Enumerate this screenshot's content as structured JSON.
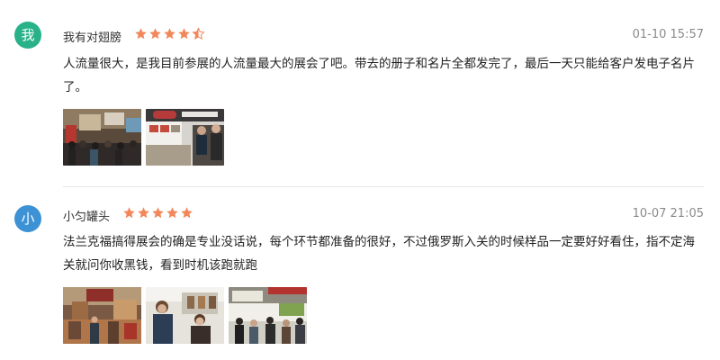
{
  "reviews": [
    {
      "avatar_char": "我",
      "avatar_color": "#29b189",
      "username": "我有对翅膀",
      "rating": 4.5,
      "timestamp": "01-10 15:57",
      "content": "人流量很大，是我目前参展的人流量最大的展会了吧。带去的册子和名片全都发完了，最后一天只能给客户发电子名片了。",
      "photos": [
        "exhibition-hall-photo",
        "exhibition-booth-photo"
      ]
    },
    {
      "avatar_char": "小",
      "avatar_color": "#3c92d5",
      "username": "小匀罐头",
      "rating": 5,
      "timestamp": "10-07 21:05",
      "content": "法兰克福搞得展会的确是专业没话说，每个环节都准备的很好，不过俄罗斯入关的时候样品一定要好好看住，指不定海关就问你收黑钱，看到时机该跑就跑",
      "photos": [
        "exhibition-hall-photo",
        "visitors-photo",
        "crowd-photo"
      ]
    }
  ],
  "colors": {
    "star": "#f1875a",
    "divider": "#e6e6e6",
    "timestamp": "#8a8a8a"
  }
}
